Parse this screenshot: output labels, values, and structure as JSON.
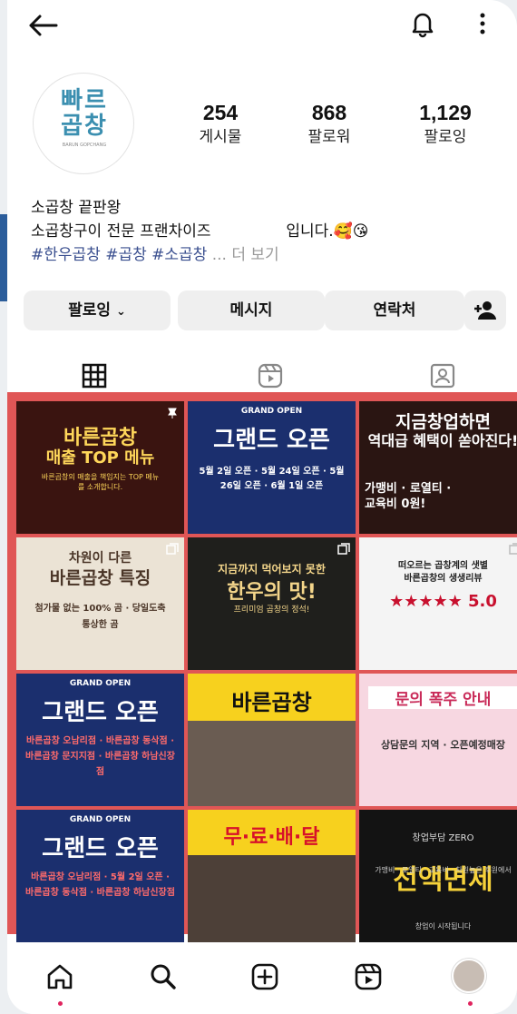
{
  "profile": {
    "logo_text": "빠르\n곱창",
    "logo_sub": "BARUN GOPCHANG",
    "stats": [
      {
        "value": "254",
        "label": "게시물"
      },
      {
        "value": "868",
        "label": "팔로워"
      },
      {
        "value": "1,129",
        "label": "팔로잉"
      }
    ],
    "bio": {
      "name": "소곱창 끝판왕",
      "line2_a": "소곱창구이 전문 프랜차이즈",
      "line2_b": "입니다.🥰😘",
      "tags": "#한우곱창 #곱창 #소곱창",
      "more": "... 더 보기"
    }
  },
  "actions": {
    "following": "팔로잉",
    "message": "메시지",
    "contact": "연락처"
  },
  "posts": [
    {
      "title": "바른곱창",
      "subtitle": "매출 TOP 메뉴",
      "body": "바른곱창의 매출을 책임지는 TOP 메뉴를 소개합니다.",
      "bg": "#3a1410",
      "fg": "#ffd75a"
    },
    {
      "title": "GRAND OPEN",
      "subtitle": "그랜드 오픈",
      "body": "5월 2일 오픈 · 5월 24일 오픈 · 5월 26일 오픈 · 6월 1일 오픈",
      "bg": "#1b2f6e",
      "fg": "#ffffff"
    },
    {
      "title": "지금창업하면",
      "subtitle": "역대급 혜택이 쏟아진다!",
      "body": "가맹비 · 로열티 · 교육비 0원!",
      "bg": "#2a1512",
      "fg": "#ffffff"
    },
    {
      "title": "차원이 다른",
      "subtitle": "바른곱창 특징",
      "body": "첨가물 없는 100% 곰 · 당일도축 통상한 곰",
      "bg": "#ebe3d5",
      "fg": "#4a3527"
    },
    {
      "title": "지금까지 먹어보지 못한",
      "subtitle": "한우의 맛!",
      "body": "프리미엄 곱창의 정석!",
      "bg": "#1f1f1c",
      "fg": "#f3d58a"
    },
    {
      "title": "떠오르는 곱창계의 샛별",
      "subtitle": "바른곱창의 생생리뷰",
      "body": "★★★★★ 5.0",
      "bg": "#f4f4f4",
      "fg": "#222222"
    },
    {
      "title": "GRAND OPEN",
      "subtitle": "그랜드 오픈",
      "body": "바른곱창 오남리점 · 바른곱창 동삭점 · 바른곱창 문지지점 · 바른곱창 하남신장점",
      "bg": "#1b2f6e",
      "fg": "#ffffff"
    },
    {
      "title": "바른곱창",
      "subtitle": "",
      "body": "",
      "bg": "#6a5c52",
      "fg": "#111111"
    },
    {
      "title": "문의 폭주 안내",
      "subtitle": "",
      "body": "상담문의 지역 · 오픈예정매장",
      "bg": "#f7d7e1",
      "fg": "#c92b59"
    },
    {
      "title": "GRAND OPEN",
      "subtitle": "그랜드 오픈",
      "body": "바른곱창 오남리점 · 5월 2일 오픈 · 바른곱창 동삭점 · 바른곱창 하남신장점",
      "bg": "#1b2f6e",
      "fg": "#ffffff"
    },
    {
      "title": "무·료·배·달",
      "subtitle": "",
      "body": "",
      "bg": "#4d4038",
      "fg": "#111111"
    },
    {
      "title": "창업부담 ZERO",
      "subtitle": "전액면제",
      "body": "가맹비 · 로열티 · 교육비 · 차원높은 후원에서 창업이 시작됩니다",
      "bg": "#131313",
      "fg": "#f6d23a"
    }
  ],
  "colors": {
    "grid_highlight": "#e05656",
    "tag_link": "#3a4f8f",
    "notification_dot": "#e0245e"
  },
  "icons": {
    "back": "arrow-left-icon",
    "notifications": "bell-icon",
    "more": "kebab-icon",
    "add_user": "add-user-icon",
    "tab_grid": "grid-icon",
    "tab_reels": "reels-icon",
    "tab_tagged": "tagged-icon",
    "nav_home": "home-icon",
    "nav_search": "search-icon",
    "nav_create": "plus-square-icon",
    "nav_reels": "reels-icon",
    "nav_profile": "avatar"
  }
}
